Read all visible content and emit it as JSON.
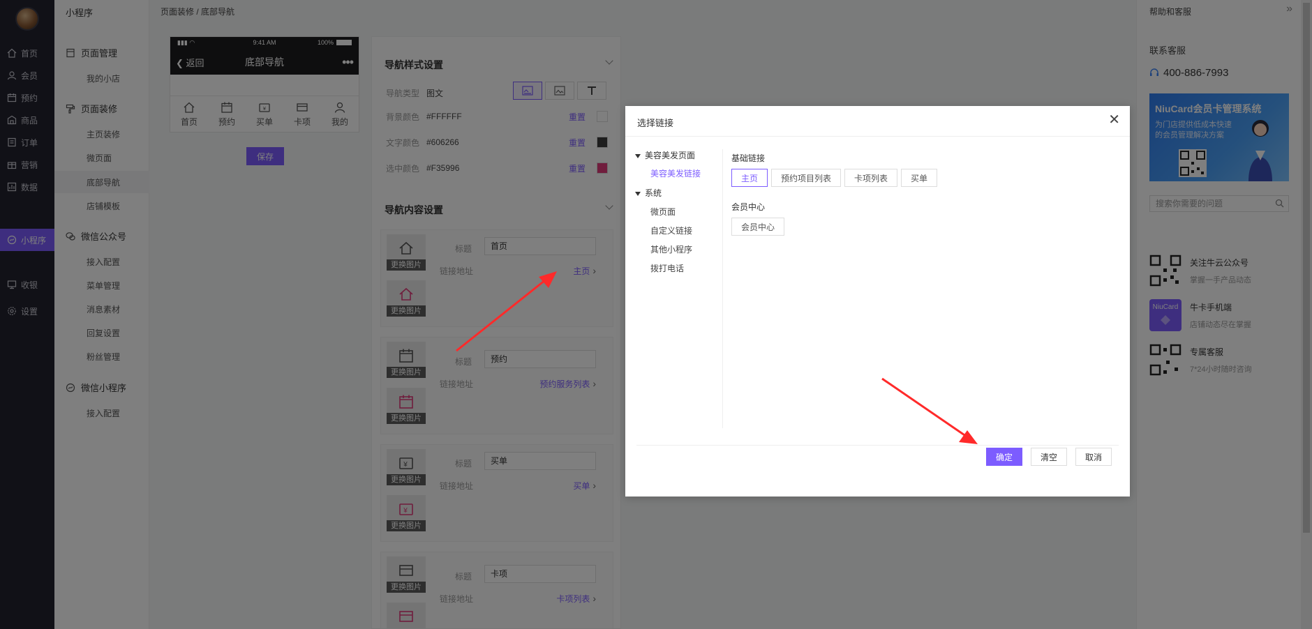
{
  "rail": {
    "items": [
      {
        "label": "首页",
        "icon": "home-icon"
      },
      {
        "label": "会员",
        "icon": "member-icon"
      },
      {
        "label": "预约",
        "icon": "booking-icon"
      },
      {
        "label": "商品",
        "icon": "goods-icon"
      },
      {
        "label": "订单",
        "icon": "order-icon"
      },
      {
        "label": "营销",
        "icon": "marketing-icon"
      },
      {
        "label": "数据",
        "icon": "data-icon"
      },
      {
        "label": "小程序",
        "icon": "miniapp-icon",
        "active": true
      },
      {
        "label": "收银",
        "icon": "cashier-icon"
      },
      {
        "label": "设置",
        "icon": "settings-icon"
      }
    ]
  },
  "submenu": {
    "title": "小程序",
    "groups": [
      {
        "label": "页面管理",
        "items": [
          "我的小店"
        ]
      },
      {
        "label": "页面装修",
        "items": [
          "主页装修",
          "微页面",
          "底部导航",
          "店铺模板"
        ]
      },
      {
        "label": "微信公众号",
        "items": [
          "接入配置",
          "菜单管理",
          "消息素材",
          "回复设置",
          "粉丝管理"
        ]
      },
      {
        "label": "微信小程序",
        "items": [
          "接入配置"
        ]
      }
    ],
    "active_item": "底部导航"
  },
  "breadcrumb": "页面装修 / 底部导航",
  "phone": {
    "status_time": "9:41 AM",
    "status_battery": "100%",
    "back_label": "返回",
    "nav_title": "底部导航",
    "tabs": [
      "首页",
      "预约",
      "买单",
      "卡项",
      "我的"
    ]
  },
  "save_label": "保存",
  "style_section": {
    "title": "导航样式设置",
    "type_label": "导航类型",
    "type_value": "图文",
    "bg_label": "背景颜色",
    "bg_value": "#FFFFFF",
    "text_label": "文字颜色",
    "text_value": "#606266",
    "sel_label": "选中颜色",
    "sel_value": "#F35996",
    "reset_label": "重置"
  },
  "content_section": {
    "title": "导航内容设置",
    "change_img": "更换图片",
    "title_label": "标题",
    "link_label": "链接地址",
    "cards": [
      {
        "title": "首页",
        "link": "主页"
      },
      {
        "title": "预约",
        "link": "预约服务列表"
      },
      {
        "title": "买单",
        "link": "买单"
      },
      {
        "title": "卡项",
        "link": "卡项列表"
      }
    ]
  },
  "modal": {
    "title": "选择链接",
    "tree": {
      "root1": "美容美发页面",
      "root1_child": "美容美发链接",
      "root2": "系统",
      "root2_children": [
        "微页面",
        "自定义链接",
        "其他小程序",
        "拨打电话"
      ]
    },
    "basic_head": "基础链接",
    "basic_links": [
      "主页",
      "预约项目列表",
      "卡项列表",
      "买单"
    ],
    "member_head": "会员中心",
    "member_links": [
      "会员中心"
    ],
    "confirm": "确定",
    "clear": "清空",
    "cancel": "取消"
  },
  "help": {
    "title": "帮助和客服",
    "contact": "联系客服",
    "phone": "400-886-7993",
    "banner_title": "NiuCard会员卡管理系统",
    "banner_sub1": "为门店提供低成本快速",
    "banner_sub2": "的会员管理解决方案",
    "search_placeholder": "搜索你需要的问题",
    "items": [
      {
        "title": "关注牛云公众号",
        "sub": "掌握一手产品动态"
      },
      {
        "title": "牛卡手机端",
        "sub": "店铺动态尽在掌握"
      },
      {
        "title": "专属客服",
        "sub": "7*24小时随时咨询"
      }
    ],
    "niucard_logo": "NiuCard"
  },
  "colors": {
    "accent": "#7c5cff",
    "rail_bg": "#23232f",
    "text_color_swatch": "#3d3d3d",
    "selected_swatch": "#F35996",
    "arrow": "#ff2a2a"
  }
}
